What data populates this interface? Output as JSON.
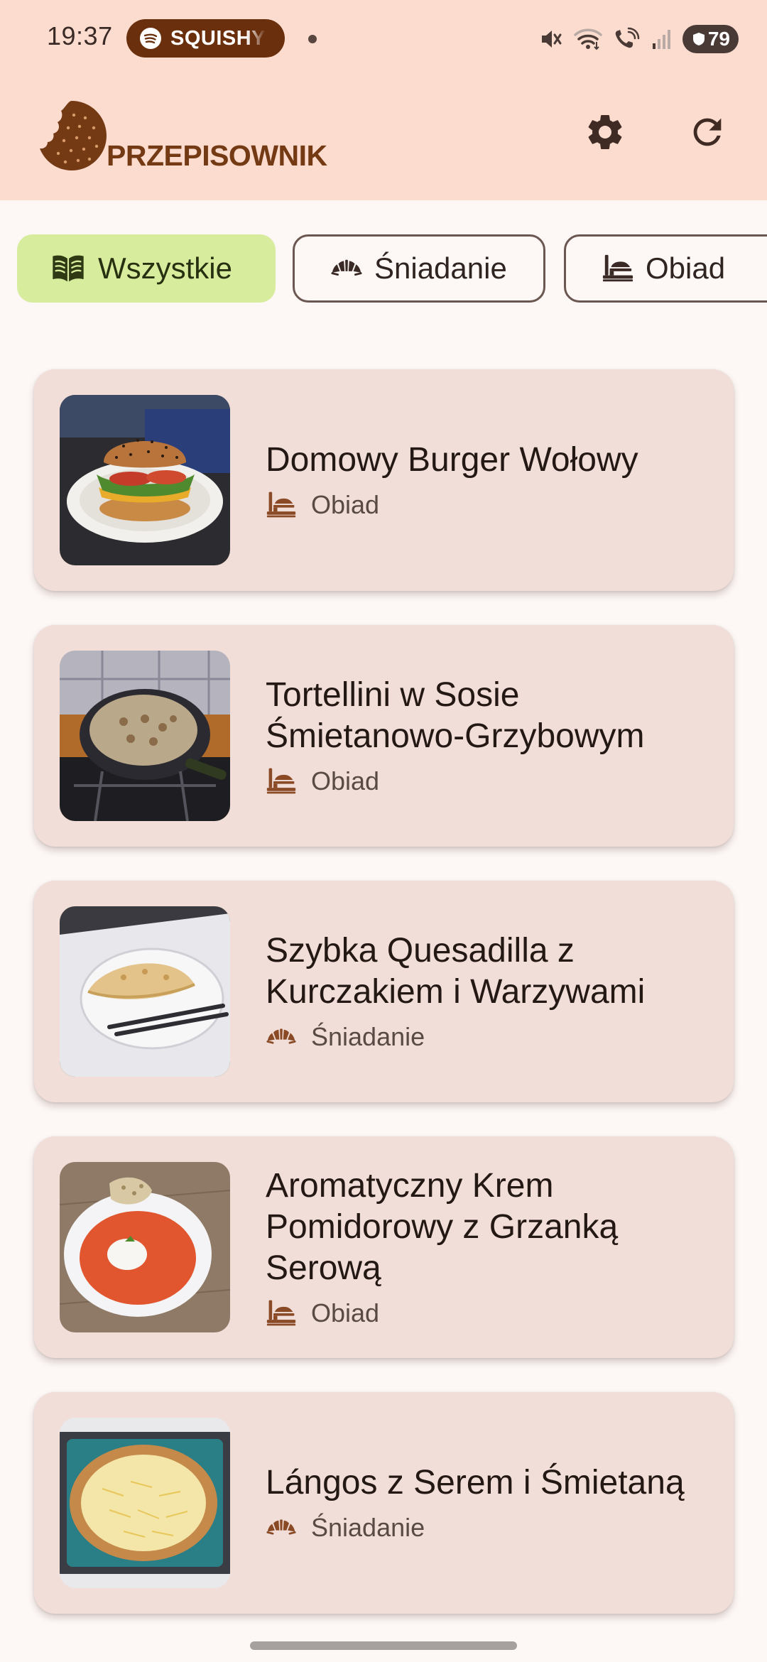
{
  "status_bar": {
    "time": "19:37",
    "media_pill_label": "SQUISHY",
    "battery_level": "79"
  },
  "app_bar": {
    "title": "PRZEPISOWNIK",
    "settings_icon": "gear-icon",
    "refresh_icon": "refresh-icon"
  },
  "colors": {
    "app_bar_bg": "#fddcd0",
    "brand_brown": "#733a14",
    "chip_selected_bg": "#d7ec9c",
    "card_bg": "#f1ded8",
    "page_bg": "#fdf7f5"
  },
  "categories": [
    {
      "label": "Wszystkie",
      "icon": "book-icon",
      "selected": true
    },
    {
      "label": "Śniadanie",
      "icon": "croissant-icon",
      "selected": false
    },
    {
      "label": "Obiad",
      "icon": "dinner-icon",
      "selected": false
    }
  ],
  "recipes": [
    {
      "title": "Domowy Burger Wołowy",
      "category": "Obiad",
      "category_icon": "dinner-icon",
      "image": "burger-photo"
    },
    {
      "title": "Tortellini w Sosie Śmietanowo-Grzybowym",
      "category": "Obiad",
      "category_icon": "dinner-icon",
      "image": "tortellini-photo"
    },
    {
      "title": "Szybka Quesadilla z Kurczakiem i Warzywami",
      "category": "Śniadanie",
      "category_icon": "croissant-icon",
      "image": "quesadilla-photo"
    },
    {
      "title": "Aromatyczny Krem Pomidorowy z Grzanką Serową",
      "category": "Obiad",
      "category_icon": "dinner-icon",
      "image": "tomato-soup-photo"
    },
    {
      "title": "Lángos z Serem i Śmietaną",
      "category": "Śniadanie",
      "category_icon": "croissant-icon",
      "image": "langos-photo"
    }
  ]
}
